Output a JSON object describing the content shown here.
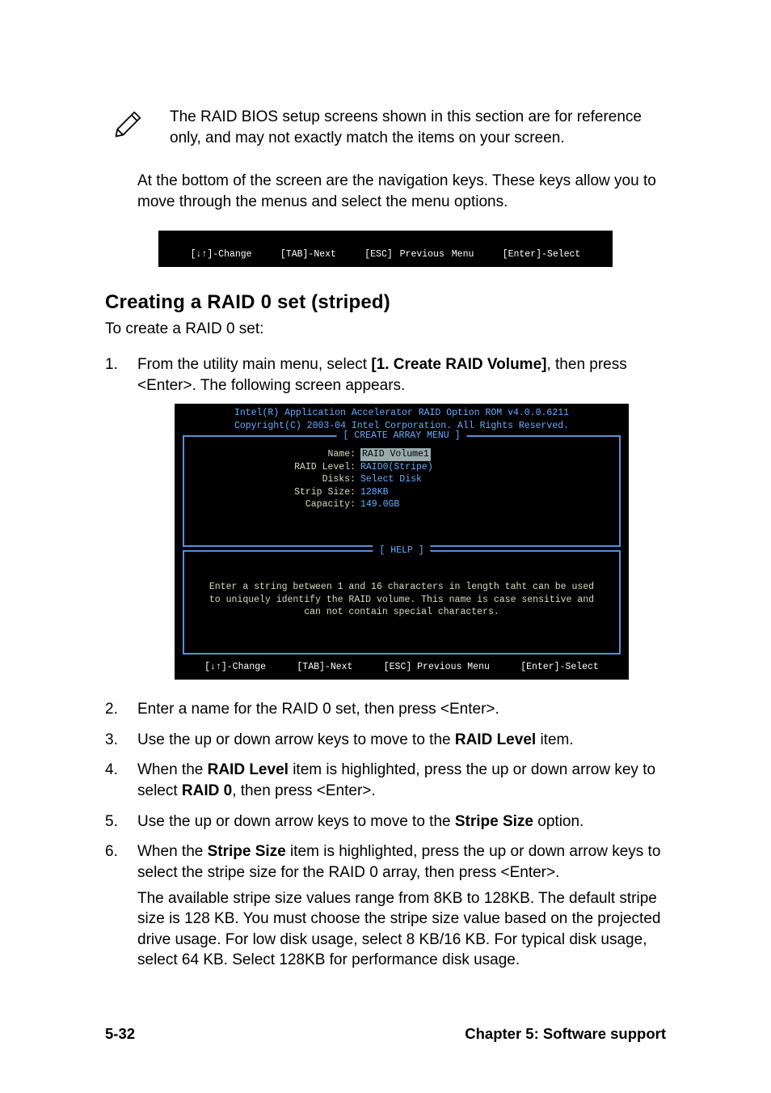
{
  "note": {
    "text": "The RAID BIOS  setup screens shown in this section are for reference only, and may not exactly match the items on your screen."
  },
  "para_nav": "At the bottom of the screen are the navigation keys. These keys allow you to move through the menus and select the menu options.",
  "navkeys": {
    "change": "[↓↑]-Change",
    "next": "[TAB]-Next",
    "prev": "[ESC] Previous Menu",
    "select": "[Enter]-Select"
  },
  "section_title": "Creating a RAID 0 set (striped)",
  "section_sub": "To create a RAID 0 set:",
  "steps": {
    "s1a": "From the utility main menu, select ",
    "s1b": "[1. Create RAID Volume]",
    "s1c": ", then press <Enter>. The following screen appears.",
    "s2": "Enter a name for the RAID 0 set, then press <Enter>.",
    "s3a": "Use the up or down arrow keys to move to the ",
    "s3b": "RAID Level",
    "s3c": " item.",
    "s4a": "When the ",
    "s4b": "RAID Level",
    "s4c": " item is highlighted, press the up or down arrow key to select ",
    "s4d": "RAID 0",
    "s4e": ", then press <Enter>.",
    "s5a": "Use the up or down arrow keys to move to the ",
    "s5b": "Stripe Size",
    "s5c": " option.",
    "s6a": "When the ",
    "s6b": "Stripe Size",
    "s6c": " item is highlighted, press the up or down arrow keys to select the stripe size for the RAID 0 array, then press <Enter>.",
    "s6p": "The available stripe size values range from 8KB to 128KB. The default stripe size is 128 KB. You must choose the stripe size value based on the projected drive usage. For low disk usage, select 8 KB/16 KB. For typical disk usage, select 64 KB. Select 128KB for performance disk usage."
  },
  "bios": {
    "title1": "Intel(R) Application Accelerator RAID Option ROM v4.0.0.6211",
    "title2": "Copyright(C) 2003-04 Intel Corporation. All Rights Reserved.",
    "panel1_title": "CREATE ARRAY MENU",
    "rows": [
      {
        "label": "Name:",
        "value": "RAID Volume1",
        "sel": true
      },
      {
        "label": "RAID Level:",
        "value": "RAID0(Stripe)",
        "sel": false
      },
      {
        "label": "Disks:",
        "value": "Select Disk",
        "sel": false
      },
      {
        "label": "Strip Size:",
        "value": "128KB",
        "sel": false
      },
      {
        "label": "Capacity:",
        "value": "149.0GB",
        "sel": false
      }
    ],
    "panel2_title": "HELP",
    "help_text": "Enter a string between 1 and 16 characters in length taht can be used to uniquely identify the RAID volume. This name is case sensitive and can not contain special characters."
  },
  "footer": {
    "left": "5-32",
    "right": "Chapter 5: Software support"
  }
}
